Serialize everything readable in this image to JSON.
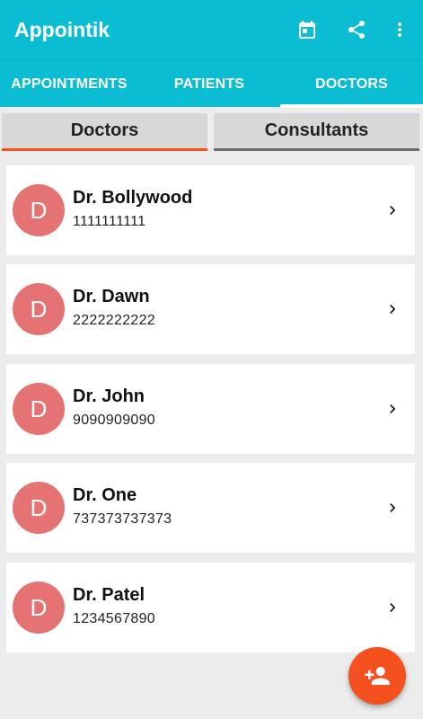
{
  "app": {
    "title": "Appointik"
  },
  "toolbar": {
    "icons": [
      "calendar-icon",
      "share-icon",
      "more-vert-icon"
    ]
  },
  "tabs": [
    {
      "label": "APPOINTMENTS",
      "selected": false
    },
    {
      "label": "PATIENTS",
      "selected": false
    },
    {
      "label": "DOCTORS",
      "selected": true
    }
  ],
  "segments": [
    {
      "label": "Doctors",
      "selected": true
    },
    {
      "label": "Consultants",
      "selected": false
    }
  ],
  "doctors": [
    {
      "initial": "D",
      "name": "Dr. Bollywood",
      "phone": "1111111111"
    },
    {
      "initial": "D",
      "name": "Dr. Dawn",
      "phone": "2222222222"
    },
    {
      "initial": "D",
      "name": "Dr. John",
      "phone": "9090909090"
    },
    {
      "initial": "D",
      "name": "Dr. One",
      "phone": "737373737373"
    },
    {
      "initial": "D",
      "name": "Dr. Patel",
      "phone": "1234567890"
    }
  ],
  "fab": {
    "icon": "add-person-icon"
  },
  "colors": {
    "primary": "#0bbdd3",
    "accent": "#f4511e",
    "avatar": "#e57373"
  }
}
